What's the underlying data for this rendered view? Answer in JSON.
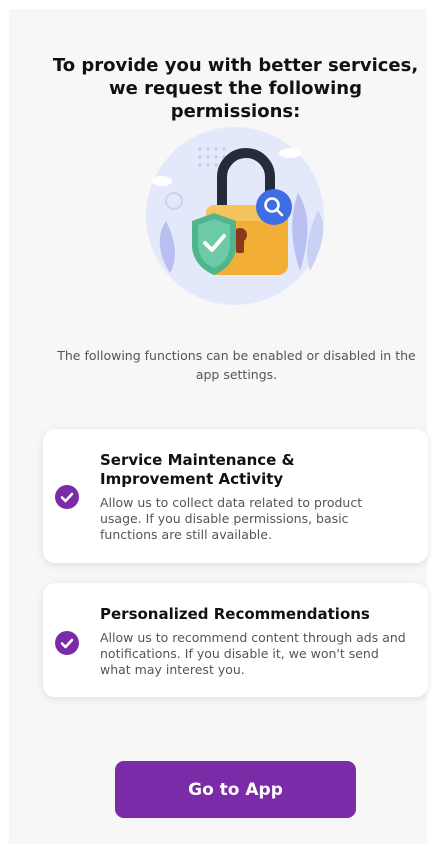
{
  "header": {
    "title": "To provide you with better services, we request the following permissions:"
  },
  "illustration": {
    "icon": "padlock-shield-search-icon"
  },
  "note": "The following functions can be enabled or disabled in the app settings.",
  "permissions": [
    {
      "title": "Service Maintenance & Improvement Activity",
      "description": "Allow us to collect data related to product usage. If you disable permissions, basic functions are still available.",
      "checked": true
    },
    {
      "title": "Personalized Recommendations",
      "description": "Allow us to recommend content through ads and notifications. If you disable it, we won't send what may interest you.",
      "checked": true
    }
  ],
  "cta": {
    "label": "Go to App"
  },
  "colors": {
    "accent": "#7b2aa8",
    "background": "#f7f7f8",
    "card": "#ffffff"
  }
}
